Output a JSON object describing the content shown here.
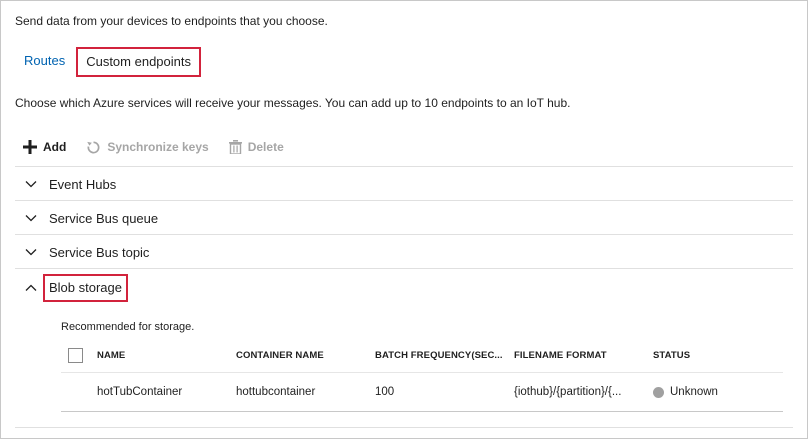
{
  "description": "Send data from your devices to endpoints that you choose.",
  "tabs": [
    {
      "label": "Routes"
    },
    {
      "label": "Custom endpoints"
    }
  ],
  "info": "Choose which Azure services will receive your messages. You can add up to 10 endpoints to an IoT hub.",
  "toolbar": {
    "add_label": "Add",
    "sync_label": "Synchronize keys",
    "delete_label": "Delete"
  },
  "sections": [
    {
      "label": "Event Hubs"
    },
    {
      "label": "Service Bus queue"
    },
    {
      "label": "Service Bus topic"
    },
    {
      "label": "Blob storage"
    }
  ],
  "blob": {
    "recommendation": "Recommended for storage.",
    "columns": [
      "NAME",
      "CONTAINER NAME",
      "BATCH FREQUENCY(SEC...",
      "FILENAME FORMAT",
      "STATUS"
    ],
    "rows": [
      {
        "name": "hotTubContainer",
        "container": "hottubcontainer",
        "batch": "100",
        "filename": "{iothub}/{partition}/{...",
        "status": "Unknown"
      }
    ]
  },
  "colors": {
    "link": "#0063b1",
    "highlight": "#d2233c",
    "status_unknown": "#a0a0a0"
  }
}
